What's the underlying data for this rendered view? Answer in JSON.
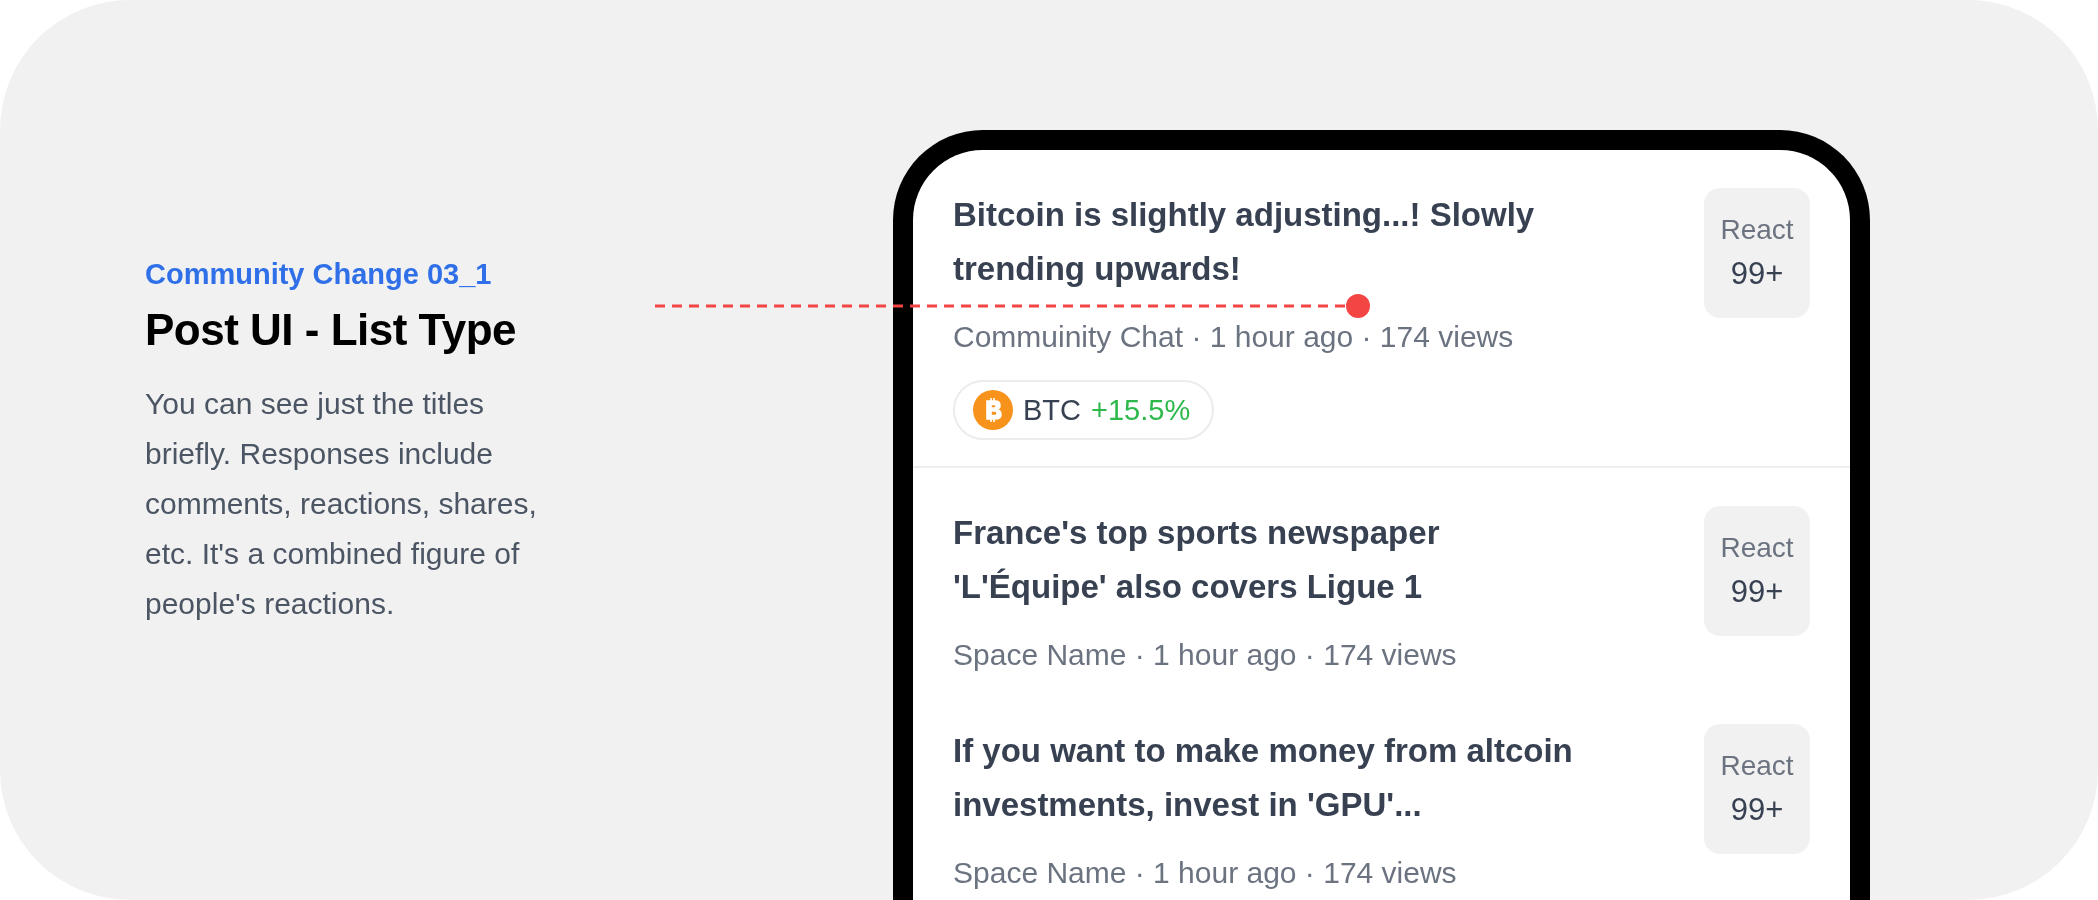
{
  "intro": {
    "label": "Community Change 03_1",
    "title": "Post UI - List Type",
    "description": "You can see just the titles briefly. Responses include comments, reactions, shares, etc. It's a combined figure of people's reactions."
  },
  "posts": [
    {
      "title": "Bitcoin is slightly adjusting...! Slowly trending upwards!",
      "meta": "Commuinity Chat · 1 hour ago · 174 views",
      "react_label": "React",
      "react_count": "99+",
      "chip": {
        "symbol": "BTC",
        "change": "+15.5%",
        "color": "#2db84b"
      }
    },
    {
      "title": "France's top sports newspaper 'L'Équipe' also covers Ligue 1",
      "meta": "Space Name · 1 hour ago · 174 views",
      "react_label": "React",
      "react_count": "99+"
    },
    {
      "title": "If you want to make money from altcoin investments, invest in 'GPU'...",
      "meta": "Space Name · 1 hour ago · 174 views",
      "react_label": "React",
      "react_count": "99+"
    }
  ]
}
